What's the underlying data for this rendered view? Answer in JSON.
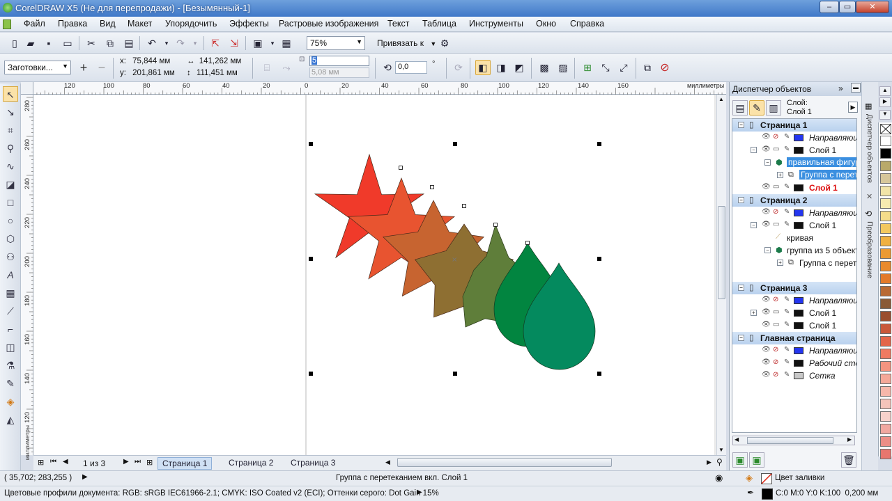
{
  "titlebar": {
    "title": "CorelDRAW X5 (Не для перепродажи) - [Безымянный-1]",
    "minimize": "–",
    "maximize": "▭",
    "close": "✕"
  },
  "menu": [
    "Файл",
    "Правка",
    "Вид",
    "Макет",
    "Упорядочить",
    "Эффекты",
    "Растровые изображения",
    "Текст",
    "Таблица",
    "Инструменты",
    "Окно",
    "Справка"
  ],
  "standard_toolbar": {
    "zoom": "75%",
    "snap_label": "Привязать к"
  },
  "property_bar": {
    "presets": "Заготовки...",
    "x_label": "x:",
    "x_value": "75,844 мм",
    "y_label": "y:",
    "y_value": "201,861 мм",
    "width_value": "141,262 мм",
    "height_value": "111,451 мм",
    "steps_value": "5",
    "spacing_value": "5,08 мм",
    "rotation_value": "0,0",
    "degree_sign": "°"
  },
  "ruler_h": {
    "ticks": [
      "120",
      "100",
      "80",
      "60",
      "40",
      "20",
      "0",
      "20",
      "40",
      "60",
      "80",
      "100",
      "120",
      "140",
      "160"
    ],
    "unit": "миллиметры"
  },
  "ruler_v": {
    "ticks": [
      "280",
      "260",
      "240",
      "220",
      "200",
      "180",
      "160",
      "140",
      "120"
    ],
    "unit": "миллиметры"
  },
  "shapes": {
    "star_colors": [
      "#f03a2a",
      "#e85430",
      "#c76430",
      "#8e6f32",
      "#5f7e3a"
    ],
    "drop_colors": [
      "#028540",
      "#048a5e"
    ]
  },
  "pages": {
    "counter": "1 из 3",
    "tabs": [
      "Страница 1",
      "Страница 2",
      "Страница 3"
    ]
  },
  "docker": {
    "title": "Диспетчер объектов",
    "layer_label": "Слой:",
    "layer_value": "Слой 1",
    "tree": [
      {
        "kind": "page",
        "label": "Страница 1"
      },
      {
        "kind": "layer",
        "label": "Направляющие",
        "italic": true,
        "swatch": "#2436f0"
      },
      {
        "kind": "layer",
        "label": "Слой 1",
        "swatch": "#111111"
      },
      {
        "kind": "object",
        "label": "правильная фигура",
        "selected": true
      },
      {
        "kind": "object2",
        "label": "Группа с перетеканием",
        "selected": true
      },
      {
        "kind": "layer-red",
        "label": "Слой 1",
        "swatch": "#111111"
      },
      {
        "kind": "page",
        "label": "Страница 2"
      },
      {
        "kind": "layer",
        "label": "Направляющие",
        "italic": true,
        "swatch": "#2436f0"
      },
      {
        "kind": "layer",
        "label": "Слой 1",
        "swatch": "#111111"
      },
      {
        "kind": "curve",
        "label": "кривая"
      },
      {
        "kind": "object",
        "label": "группа из 5 объектов"
      },
      {
        "kind": "object2",
        "label": "Группа с перетеканием"
      },
      {
        "kind": "blank",
        "label": ""
      },
      {
        "kind": "page",
        "label": "Страница 3"
      },
      {
        "kind": "layer",
        "label": "Направляющие",
        "italic": true,
        "swatch": "#2436f0"
      },
      {
        "kind": "layer",
        "label": "Слой 1",
        "swatch": "#111111"
      },
      {
        "kind": "layer",
        "label": "Слой 1",
        "swatch": "#111111"
      },
      {
        "kind": "page",
        "label": "Главная страница"
      },
      {
        "kind": "layer",
        "label": "Направляющие",
        "italic": true,
        "swatch": "#2436f0"
      },
      {
        "kind": "layer",
        "label": "Рабочий стол",
        "italic": true,
        "swatch": "#111111"
      },
      {
        "kind": "layer",
        "label": "Сетка",
        "italic": true,
        "swatch": "#c8c8c8"
      }
    ]
  },
  "side_tabs": [
    "Диспетчер объектов",
    "Преобразование"
  ],
  "palette": [
    "#ffffff",
    "#000000",
    "#b9a96a",
    "#d6c79a",
    "#f1e4a8",
    "#f7ebb0",
    "#f5dc8a",
    "#f3c85e",
    "#f0b040",
    "#ec9a32",
    "#e98a2c",
    "#e27a2a",
    "#b96a34",
    "#8a5a36",
    "#9a4e2e",
    "#c9583a",
    "#e3664a",
    "#ef7a62",
    "#f39480",
    "#f5a898",
    "#f6b7aa",
    "#f4c4ba",
    "#f7d2cb",
    "#f1a8a0",
    "#ec8e86",
    "#e8766e"
  ],
  "status": {
    "coords": "( 35,702; 283,255 )",
    "selection": "Группа с перетеканием вкл. Слой 1",
    "fill_label": "Цвет заливки",
    "color_profiles": "Цветовые профили документа: RGB: sRGB IEC61966-2.1; CMYK: ISO Coated v2 (ECI); Оттенки серого: Dot Gain 15%",
    "outline": "C:0 M:0 Y:0 K:100  0,200 мм"
  }
}
